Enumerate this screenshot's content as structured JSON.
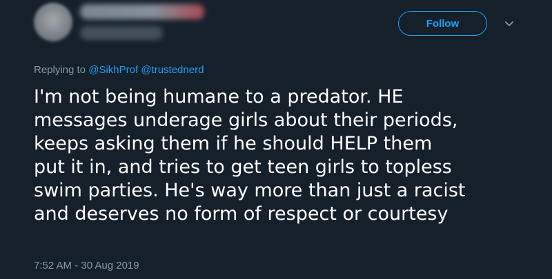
{
  "colors": {
    "background": "#15202b",
    "accent": "#1da1f2",
    "secondary_text": "#8899a6",
    "primary_text": "#ffffff"
  },
  "header": {
    "follow_label": "Follow",
    "menu_icon": "chevron-down-icon"
  },
  "reply": {
    "prefix": "Replying to",
    "mentions": [
      "@SikhProf",
      "@trustednerd"
    ]
  },
  "tweet": {
    "lines": [
      "I'm not being humane to a predator. HE",
      "messages underage girls about their periods,",
      "keeps asking them if he should HELP them",
      "put it in, and tries to get teen girls to topless",
      "swim parties. He's way more than just a racist",
      "and deserves no form of respect or courtesy"
    ]
  },
  "timestamp": "7:52 AM - 30 Aug 2019"
}
